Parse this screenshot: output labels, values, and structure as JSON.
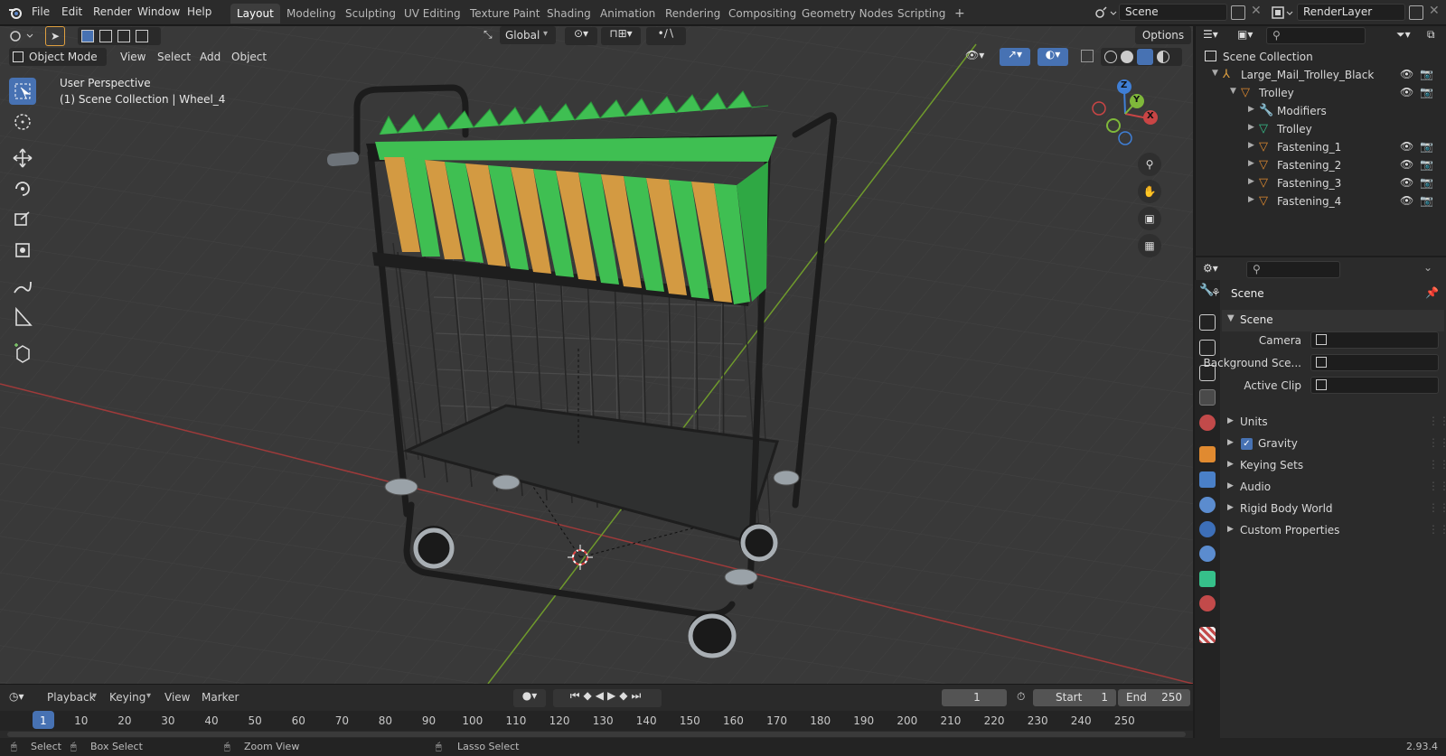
{
  "menu": {
    "items": [
      "File",
      "Edit",
      "Render",
      "Window",
      "Help"
    ],
    "workspaces": [
      "Layout",
      "Modeling",
      "Sculpting",
      "UV Editing",
      "Texture Paint",
      "Shading",
      "Animation",
      "Rendering",
      "Compositing",
      "Geometry Nodes",
      "Scripting"
    ],
    "active_workspace": "Layout",
    "add_tab": "+",
    "scene_value": "Scene",
    "view_layer_value": "RenderLayer"
  },
  "viewport": {
    "transform_orientation": "Global",
    "options_label": "Options",
    "mode": "Object Mode",
    "menus": [
      "View",
      "Select",
      "Add",
      "Object"
    ],
    "overlay_title": "User Perspective",
    "overlay_subtitle": "(1) Scene Collection | Wheel_4",
    "gizmo_axes": {
      "x": "X",
      "y": "Y",
      "z": "Z"
    }
  },
  "outliner": {
    "search_placeholder": "",
    "root": "Scene Collection",
    "rows": [
      {
        "label": "Large_Mail_Trolley_Black",
        "indent": 1,
        "icon": "armature-icon",
        "icon_color": "#e0a040",
        "eye": true
      },
      {
        "label": "Trolley",
        "indent": 2,
        "icon": "mesh-object-icon",
        "icon_color": "#e08a30",
        "eye": true
      },
      {
        "label": "Modifiers",
        "indent": 3,
        "icon": "wrench-icon",
        "icon_color": "#7aa7e0",
        "eye": false
      },
      {
        "label": "Trolley",
        "indent": 3,
        "icon": "mesh-data-icon",
        "icon_color": "#36c08a",
        "eye": false
      },
      {
        "label": "Fastening_1",
        "indent": 3,
        "icon": "mesh-object-icon",
        "icon_color": "#e08a30",
        "eye": true
      },
      {
        "label": "Fastening_2",
        "indent": 3,
        "icon": "mesh-object-icon",
        "icon_color": "#e08a30",
        "eye": true
      },
      {
        "label": "Fastening_3",
        "indent": 3,
        "icon": "mesh-object-icon",
        "icon_color": "#e08a30",
        "eye": true
      },
      {
        "label": "Fastening_4",
        "indent": 3,
        "icon": "mesh-object-icon",
        "icon_color": "#e08a30",
        "eye": true
      }
    ]
  },
  "properties": {
    "breadcrumb": "Scene",
    "panel_title": "Scene",
    "fields": [
      {
        "label": "Camera",
        "value": ""
      },
      {
        "label": "Background Sce...",
        "value": ""
      },
      {
        "label": "Active Clip",
        "value": ""
      }
    ],
    "sections": [
      {
        "label": "Units",
        "checkbox": false
      },
      {
        "label": "Gravity",
        "checkbox": true
      },
      {
        "label": "Keying Sets",
        "checkbox": false
      },
      {
        "label": "Audio",
        "checkbox": false
      },
      {
        "label": "Rigid Body World",
        "checkbox": false
      },
      {
        "label": "Custom Properties",
        "checkbox": false
      }
    ]
  },
  "timeline": {
    "menus": [
      "Playback",
      "Keying",
      "View",
      "Marker"
    ],
    "current_frame": "1",
    "start_label": "Start",
    "start_value": "1",
    "end_label": "End",
    "end_value": "250",
    "ruler": [
      "1",
      "10",
      "20",
      "30",
      "40",
      "50",
      "60",
      "70",
      "80",
      "90",
      "100",
      "110",
      "120",
      "130",
      "140",
      "150",
      "160",
      "170",
      "180",
      "190",
      "200",
      "210",
      "220",
      "230",
      "240",
      "250"
    ]
  },
  "status": {
    "select": "Select",
    "box_select": "Box Select",
    "zoom_view": "Zoom View",
    "lasso_select": "Lasso Select",
    "version": "2.93.4"
  },
  "colors": {
    "accent": "#4772b3",
    "folder_green": "#3fbf52",
    "folder_orange": "#d39a42",
    "x_axis": "#c94545",
    "y_axis": "#7fb83a",
    "z_axis": "#3f7fd6"
  }
}
